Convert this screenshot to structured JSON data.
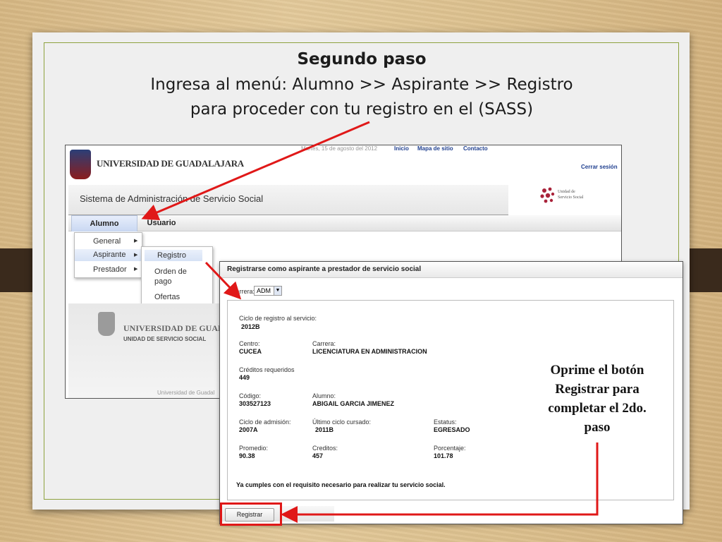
{
  "slide": {
    "title": "Segundo paso",
    "line2": "Ingresa al menú: Alumno >> Aspirante >> Registro",
    "line3": "para proceder con tu registro en el (SASS)",
    "callout": [
      "Oprime el botón",
      "Registrar para",
      "completar el 2do.",
      "paso"
    ]
  },
  "portal": {
    "date_text": "Martes, 15 de agosto del 2012",
    "links": [
      "Inicio",
      "Mapa de sitio",
      "Contacto"
    ],
    "university_name": "UNIVERSIDAD DE GUADALAJARA",
    "logout": "Cerrar sesión",
    "system_title": "Sistema de Administración de Servicio Social",
    "unit_logo_text": [
      "Unidad de",
      "Servicio Social"
    ],
    "menu": [
      "Alumno",
      "Usuario"
    ],
    "alumno_submenu": [
      "General",
      "Aspirante",
      "Prestador"
    ],
    "aspirante_submenu": [
      "Registro",
      "Orden de pago",
      "Ofertas disponibles"
    ],
    "footer_university": "UNIVERSIDAD DE GUADALAJARA",
    "footer_unit": "UNIDAD DE SERVICIO SOCIAL",
    "footer_copy": "Universidad de Guadal"
  },
  "form": {
    "header": "Registrarse como aspirante a prestador de servicio social",
    "carrera_label": "Carrera:",
    "carrera_value": "ADM",
    "ciclo_registro_label": "Ciclo de registro al servicio:",
    "ciclo_registro_value": "2012B",
    "centro_label": "Centro:",
    "centro_value": "CUCEA",
    "carrera2_label": "Carrera:",
    "carrera2_value": "LICENCIATURA EN ADMINISTRACION",
    "creditos_req_label": "Créditos requeridos",
    "creditos_req_value": "449",
    "codigo_label": "Código:",
    "codigo_value": "303527123",
    "alumno_label": "Alumno:",
    "alumno_value": "ABIGAIL GARCIA JIMENEZ",
    "ciclo_admision_label": "Ciclo de admisión:",
    "ciclo_admision_value": "2007A",
    "ultimo_ciclo_label": "Último ciclo cursado:",
    "ultimo_ciclo_value": "2011B",
    "estatus_label": "Estatus:",
    "estatus_value": "EGRESADO",
    "promedio_label": "Promedio:",
    "promedio_value": "90.38",
    "creditos_label": "Creditos:",
    "creditos_value": "457",
    "porcentaje_label": "Porcentaje:",
    "porcentaje_value": "101.78",
    "requirement_message": "Ya cumples con el requisito necesario para realizar tu servicio social.",
    "register_button": "Registrar"
  },
  "colors": {
    "annotation_red": "#e01818",
    "link_blue": "#1f3f8f",
    "frame_green": "#8da23e"
  }
}
